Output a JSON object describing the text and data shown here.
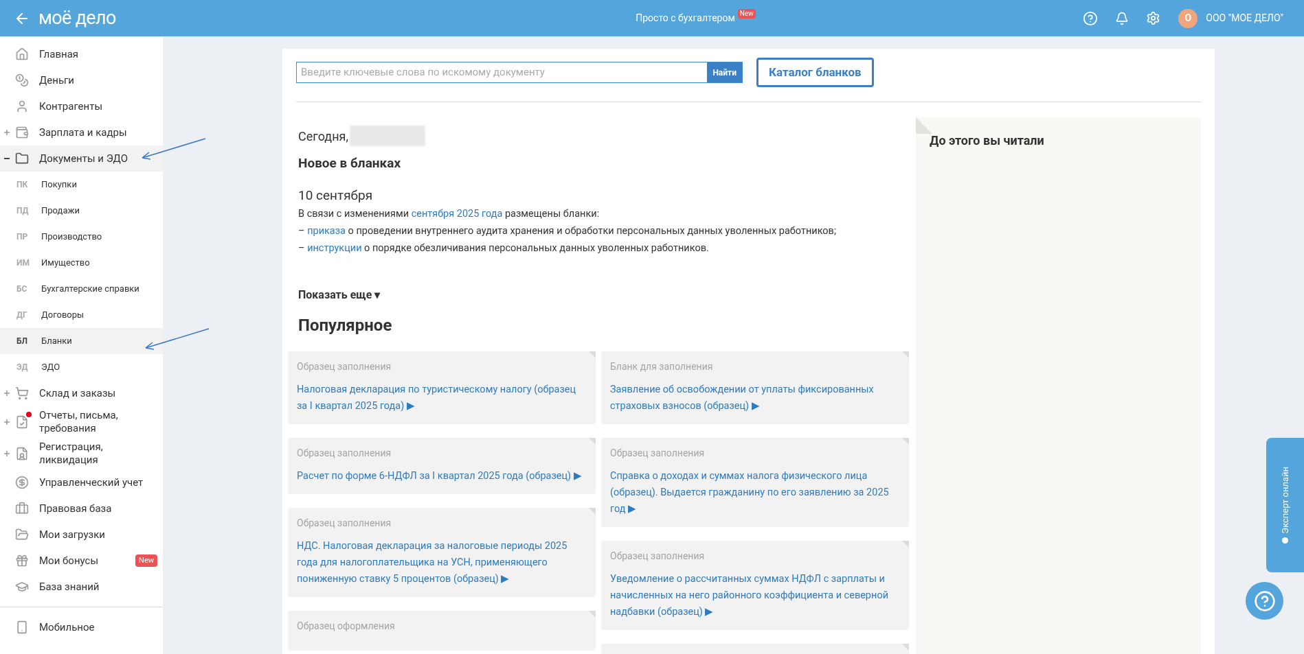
{
  "header": {
    "logo": "моё дело",
    "promo": {
      "label": "Просто с бухгалтером",
      "badge": "New"
    },
    "avatar_letter": "О",
    "company": "ООО \"МОЕ ДЕЛО\""
  },
  "sidebar": {
    "items": [
      {
        "kind": "main",
        "label": "Главная",
        "selected": false
      },
      {
        "kind": "main",
        "label": "Деньги",
        "selected": false
      },
      {
        "kind": "main",
        "label": "Контрагенты",
        "selected": false
      },
      {
        "kind": "main",
        "label": "Зарплата и кадры",
        "selected": false,
        "expanded": false
      },
      {
        "kind": "main",
        "label": "Документы и ЭДО",
        "selected": true,
        "expanded": true,
        "children": [
          {
            "abbr": "ПК",
            "label": "Покупки",
            "selected": false
          },
          {
            "abbr": "ПД",
            "label": "Продажи",
            "selected": false
          },
          {
            "abbr": "ПР",
            "label": "Производство",
            "selected": false
          },
          {
            "abbr": "ИМ",
            "label": "Имущество",
            "selected": false
          },
          {
            "abbr": "БС",
            "label": "Бухгалтерские справки",
            "selected": false
          },
          {
            "abbr": "ДГ",
            "label": "Договоры",
            "selected": false
          },
          {
            "abbr": "БЛ",
            "label": "Бланки",
            "selected": true
          },
          {
            "abbr": "ЭД",
            "label": "ЭДО",
            "selected": false
          }
        ]
      },
      {
        "kind": "main",
        "label": "Склад и заказы",
        "selected": false,
        "expanded": false
      },
      {
        "kind": "main",
        "label": "Отчеты, письма, требования",
        "selected": false,
        "expanded": false,
        "notification": true
      },
      {
        "kind": "main",
        "label": "Регистрация, ликвидация",
        "selected": false,
        "expanded": false
      },
      {
        "kind": "main",
        "label": "Управленческий учет",
        "selected": false
      },
      {
        "kind": "main",
        "label": "Правовая база",
        "selected": false
      },
      {
        "kind": "main",
        "label": "Мои загрузки",
        "selected": false
      },
      {
        "kind": "main",
        "label": "Мои бонусы",
        "selected": false,
        "badge": "New"
      },
      {
        "kind": "main",
        "label": "База знаний",
        "selected": false
      },
      {
        "kind": "divider"
      },
      {
        "kind": "main",
        "label": "Мобильное",
        "selected": false
      }
    ]
  },
  "search": {
    "placeholder": "Введите ключевые слова по искомому документу",
    "button": "Найти"
  },
  "catalog_button": "Каталог бланков",
  "today_label": "Сегодня,",
  "news": {
    "title": "Новое в бланках",
    "date": "10 сентября",
    "lines": [
      [
        {
          "text": "В связи с изменениями ",
          "link": false
        },
        {
          "text": "сентября 2025 года",
          "link": true
        },
        {
          "text": " размещены бланки:",
          "link": false
        }
      ],
      [
        {
          "text": "– ",
          "link": false
        },
        {
          "text": "приказа",
          "link": true
        },
        {
          "text": " о проведении внутреннего аудита хранения и обработки персональных данных уволенных работников;",
          "link": false
        }
      ],
      [
        {
          "text": "– ",
          "link": false
        },
        {
          "text": "инструкции",
          "link": true
        },
        {
          "text": " о порядке обезличивания персональных данных уволенных работников.",
          "link": false
        }
      ]
    ],
    "show_more": "Показать еще ▾"
  },
  "popular": {
    "title": "Популярное",
    "columns": [
      [
        {
          "label": "Образец заполнения",
          "title": "Налоговая декларация по туристическому налогу (образец за I квартал 2025 года) ▶"
        },
        {
          "label": "Образец заполнения",
          "title": "Расчет по форме 6-НДФЛ за I квартал 2025 года (образец) ▶"
        },
        {
          "label": "Образец заполнения",
          "title": "НДС. Налоговая декларация за налоговые периоды 2025 года для налогоплательщика на УСН, применяющего пониженную ставку 5 процентов (образец) ▶"
        },
        {
          "label": "Образец оформления"
        }
      ],
      [
        {
          "label": "Бланк для заполнения",
          "title": "Заявление об освобождении от уплаты фиксированных страховых взносов (образец) ▶"
        },
        {
          "label": "Образец заполнения",
          "title": "Справка о доходах и суммах налога физического лица (образец). Выдается гражданину по его заявлению за 2025 год ▶"
        },
        {
          "label": "Образец заполнения",
          "title": "Уведомление о рассчитанных суммах НДФЛ с зарплаты и начисленных на него районного коэффициента и северной надбавки (образец) ▶"
        },
        {}
      ]
    ]
  },
  "history": {
    "title": "До этого вы читали"
  },
  "expert_tab": "Эксперт онлайн"
}
